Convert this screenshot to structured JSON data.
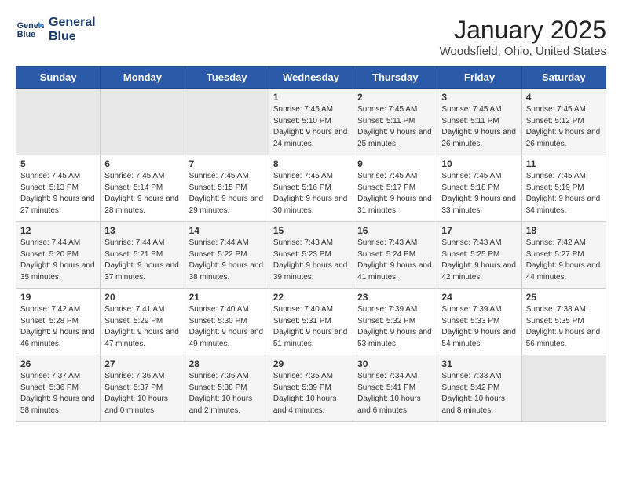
{
  "header": {
    "logo_line1": "General",
    "logo_line2": "Blue",
    "title": "January 2025",
    "subtitle": "Woodsfield, Ohio, United States"
  },
  "weekdays": [
    "Sunday",
    "Monday",
    "Tuesday",
    "Wednesday",
    "Thursday",
    "Friday",
    "Saturday"
  ],
  "weeks": [
    [
      {
        "day": "",
        "info": ""
      },
      {
        "day": "",
        "info": ""
      },
      {
        "day": "",
        "info": ""
      },
      {
        "day": "1",
        "info": "Sunrise: 7:45 AM\nSunset: 5:10 PM\nDaylight: 9 hours and 24 minutes."
      },
      {
        "day": "2",
        "info": "Sunrise: 7:45 AM\nSunset: 5:11 PM\nDaylight: 9 hours and 25 minutes."
      },
      {
        "day": "3",
        "info": "Sunrise: 7:45 AM\nSunset: 5:11 PM\nDaylight: 9 hours and 26 minutes."
      },
      {
        "day": "4",
        "info": "Sunrise: 7:45 AM\nSunset: 5:12 PM\nDaylight: 9 hours and 26 minutes."
      }
    ],
    [
      {
        "day": "5",
        "info": "Sunrise: 7:45 AM\nSunset: 5:13 PM\nDaylight: 9 hours and 27 minutes."
      },
      {
        "day": "6",
        "info": "Sunrise: 7:45 AM\nSunset: 5:14 PM\nDaylight: 9 hours and 28 minutes."
      },
      {
        "day": "7",
        "info": "Sunrise: 7:45 AM\nSunset: 5:15 PM\nDaylight: 9 hours and 29 minutes."
      },
      {
        "day": "8",
        "info": "Sunrise: 7:45 AM\nSunset: 5:16 PM\nDaylight: 9 hours and 30 minutes."
      },
      {
        "day": "9",
        "info": "Sunrise: 7:45 AM\nSunset: 5:17 PM\nDaylight: 9 hours and 31 minutes."
      },
      {
        "day": "10",
        "info": "Sunrise: 7:45 AM\nSunset: 5:18 PM\nDaylight: 9 hours and 33 minutes."
      },
      {
        "day": "11",
        "info": "Sunrise: 7:45 AM\nSunset: 5:19 PM\nDaylight: 9 hours and 34 minutes."
      }
    ],
    [
      {
        "day": "12",
        "info": "Sunrise: 7:44 AM\nSunset: 5:20 PM\nDaylight: 9 hours and 35 minutes."
      },
      {
        "day": "13",
        "info": "Sunrise: 7:44 AM\nSunset: 5:21 PM\nDaylight: 9 hours and 37 minutes."
      },
      {
        "day": "14",
        "info": "Sunrise: 7:44 AM\nSunset: 5:22 PM\nDaylight: 9 hours and 38 minutes."
      },
      {
        "day": "15",
        "info": "Sunrise: 7:43 AM\nSunset: 5:23 PM\nDaylight: 9 hours and 39 minutes."
      },
      {
        "day": "16",
        "info": "Sunrise: 7:43 AM\nSunset: 5:24 PM\nDaylight: 9 hours and 41 minutes."
      },
      {
        "day": "17",
        "info": "Sunrise: 7:43 AM\nSunset: 5:25 PM\nDaylight: 9 hours and 42 minutes."
      },
      {
        "day": "18",
        "info": "Sunrise: 7:42 AM\nSunset: 5:27 PM\nDaylight: 9 hours and 44 minutes."
      }
    ],
    [
      {
        "day": "19",
        "info": "Sunrise: 7:42 AM\nSunset: 5:28 PM\nDaylight: 9 hours and 46 minutes."
      },
      {
        "day": "20",
        "info": "Sunrise: 7:41 AM\nSunset: 5:29 PM\nDaylight: 9 hours and 47 minutes."
      },
      {
        "day": "21",
        "info": "Sunrise: 7:40 AM\nSunset: 5:30 PM\nDaylight: 9 hours and 49 minutes."
      },
      {
        "day": "22",
        "info": "Sunrise: 7:40 AM\nSunset: 5:31 PM\nDaylight: 9 hours and 51 minutes."
      },
      {
        "day": "23",
        "info": "Sunrise: 7:39 AM\nSunset: 5:32 PM\nDaylight: 9 hours and 53 minutes."
      },
      {
        "day": "24",
        "info": "Sunrise: 7:39 AM\nSunset: 5:33 PM\nDaylight: 9 hours and 54 minutes."
      },
      {
        "day": "25",
        "info": "Sunrise: 7:38 AM\nSunset: 5:35 PM\nDaylight: 9 hours and 56 minutes."
      }
    ],
    [
      {
        "day": "26",
        "info": "Sunrise: 7:37 AM\nSunset: 5:36 PM\nDaylight: 9 hours and 58 minutes."
      },
      {
        "day": "27",
        "info": "Sunrise: 7:36 AM\nSunset: 5:37 PM\nDaylight: 10 hours and 0 minutes."
      },
      {
        "day": "28",
        "info": "Sunrise: 7:36 AM\nSunset: 5:38 PM\nDaylight: 10 hours and 2 minutes."
      },
      {
        "day": "29",
        "info": "Sunrise: 7:35 AM\nSunset: 5:39 PM\nDaylight: 10 hours and 4 minutes."
      },
      {
        "day": "30",
        "info": "Sunrise: 7:34 AM\nSunset: 5:41 PM\nDaylight: 10 hours and 6 minutes."
      },
      {
        "day": "31",
        "info": "Sunrise: 7:33 AM\nSunset: 5:42 PM\nDaylight: 10 hours and 8 minutes."
      },
      {
        "day": "",
        "info": ""
      }
    ]
  ]
}
